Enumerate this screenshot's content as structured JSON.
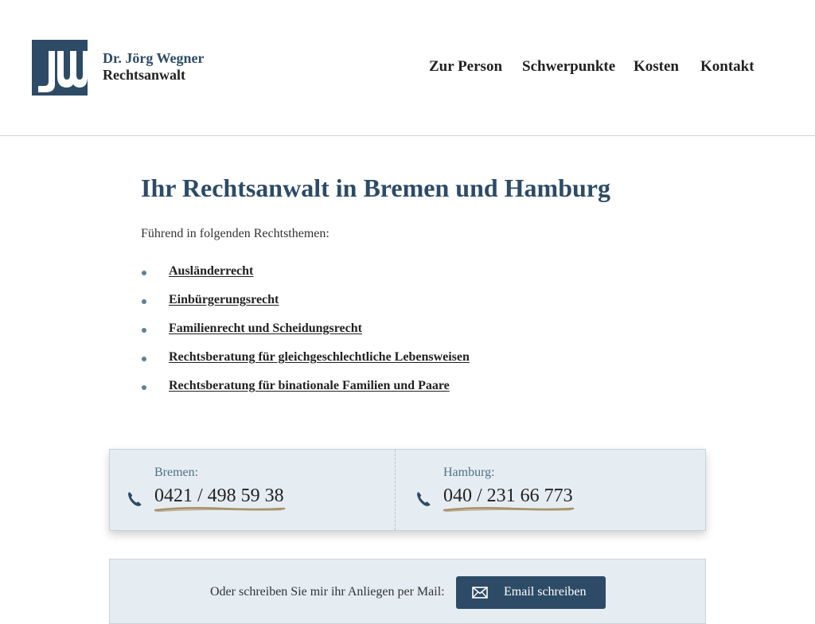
{
  "header": {
    "logo_icon": "jw-monogram-logo",
    "brand_name": "Dr. Jörg Wegner",
    "brand_title": "Rechtsanwalt",
    "nav": [
      {
        "label": "Zur Person"
      },
      {
        "label": "Schwerpunkte"
      },
      {
        "label": "Kosten"
      },
      {
        "label": "Kontakt"
      }
    ]
  },
  "main": {
    "title": "Ihr Rechtsanwalt in Bremen und Hamburg",
    "intro": "Führend in folgenden Rechtsthemen:",
    "topics": [
      {
        "label": "Ausländerrecht"
      },
      {
        "label": "Einbürgerungsrecht"
      },
      {
        "label": "Familienrecht und Scheidungsrecht"
      },
      {
        "label": "Rechtsberatung für gleichgeschlechtliche Lebensweisen"
      },
      {
        "label": "Rechtsberatung für binationale Familien und Paare"
      }
    ]
  },
  "contact": {
    "phones": [
      {
        "city": "Bremen:",
        "number": "0421 / 498 59 38",
        "icon": "phone-icon"
      },
      {
        "city": "Hamburg:",
        "number": "040 / 231 66 773",
        "icon": "phone-icon"
      }
    ],
    "mail_prompt": "Oder schreiben Sie mir ihr Anliegen per Mail:",
    "mail_button": "Email schreiben",
    "mail_icon": "envelope-icon"
  },
  "colors": {
    "primary": "#2d4b66",
    "accent_bullet": "#5b8296",
    "panel_bg": "#e6edf2",
    "underline_stroke": "#a8916a"
  }
}
